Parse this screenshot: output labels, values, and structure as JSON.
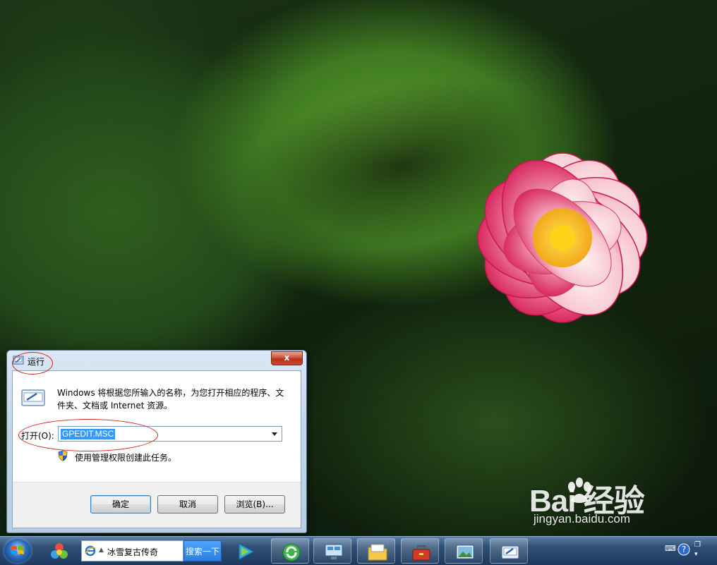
{
  "dialog": {
    "title": "运行",
    "close_glyph": "x",
    "description": "Windows 将根据您所输入的名称，为您打开相应的程序、文件夹、文档或 Internet 资源。",
    "open_label": "打开(O):",
    "open_value": "GPEDIT.MSC",
    "admin_note": "使用管理权限创建此任务。",
    "ok_label": "确定",
    "cancel_label": "取消",
    "browse_label": "浏览(B)..."
  },
  "taskbar": {
    "search_text": "冰雪复古传奇",
    "search_button": "搜索一下",
    "pinned": [
      "paint-palette-icon",
      "media-player-icon",
      "refresh-browser-icon",
      "remote-desktop-icon",
      "file-explorer-icon",
      "toolbox-icon",
      "photo-viewer-icon",
      "run-window-icon"
    ]
  },
  "watermark": {
    "logo_text": "Bai  经验",
    "url": "jingyan.baidu.com"
  },
  "colors": {
    "dialog_frame": "#c3d6ea",
    "selection": "#3399ff",
    "annotation": "#d61f1f",
    "taskbar": "#1d3a5e"
  }
}
